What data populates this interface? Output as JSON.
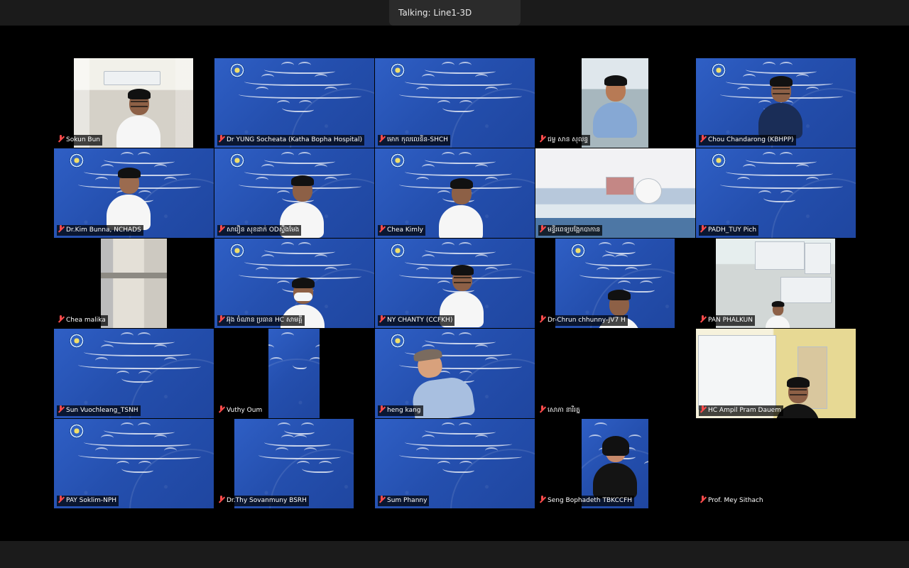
{
  "talking": {
    "label": "Talking: Line1-3D"
  },
  "colors": {
    "background": "#000000",
    "slide_blue": "#244fae",
    "muted_mic": "#ff4b4b"
  },
  "participants": [
    {
      "name": "Sokun Bun",
      "muted": true,
      "view": "camera"
    },
    {
      "name": "Dr YUNG Socheata (Katha Bopha Hospital)",
      "muted": true,
      "view": "slide"
    },
    {
      "name": "មោក កុលលេនីន-SHCH",
      "muted": true,
      "view": "slide"
    },
    {
      "name": "ជម្ល សាន សុលន្ទ",
      "muted": true,
      "view": "camera"
    },
    {
      "name": "Chou Chandarong (KBHPP)",
      "muted": true,
      "view": "slide-camera"
    },
    {
      "name": "Dr.Kim Bunna, NCHADS",
      "muted": true,
      "view": "slide-camera"
    },
    {
      "name": "សារឿន សុខដាក់ ODស្ទឹងមែង",
      "muted": true,
      "view": "slide-camera"
    },
    {
      "name": "Chea Kimly",
      "muted": true,
      "view": "slide-camera"
    },
    {
      "name": "មន្ទីរពេទ្យបង្អែកបាកាន",
      "muted": true,
      "view": "camera"
    },
    {
      "name": "PADH_TUY Pich",
      "muted": true,
      "view": "slide"
    },
    {
      "name": "Chea malika",
      "muted": true,
      "view": "camera"
    },
    {
      "name": "អ៊ុង ចំណាន ប្រធាន HC សាមគ្គី",
      "muted": true,
      "view": "slide-camera"
    },
    {
      "name": "NY CHANTY (CCFKH)",
      "muted": true,
      "view": "slide-camera"
    },
    {
      "name": "Dr-Chrun chhunny-JV7 H",
      "muted": true,
      "view": "slide-camera"
    },
    {
      "name": "PAN PHALKUN",
      "muted": true,
      "view": "camera"
    },
    {
      "name": "Sun Vuochleang_TSNH",
      "muted": true,
      "view": "slide"
    },
    {
      "name": "Vuthy Oum",
      "muted": true,
      "view": "slide"
    },
    {
      "name": "heng kang",
      "muted": true,
      "view": "slide-camera"
    },
    {
      "name": "សោភា នារីរត្ន",
      "muted": true,
      "view": "empty"
    },
    {
      "name": "HC Ampil Pram Dauem",
      "muted": true,
      "view": "camera"
    },
    {
      "name": "PAY Soklim-NPH",
      "muted": true,
      "view": "slide"
    },
    {
      "name": "Dr.Thy Sovanmuny BSRH",
      "muted": true,
      "view": "slide"
    },
    {
      "name": "Sum Phanny",
      "muted": true,
      "view": "slide"
    },
    {
      "name": "Seng Bophadeth TBKCCFH",
      "muted": true,
      "view": "camera"
    },
    {
      "name": "Prof. Mey Sithach",
      "muted": true,
      "view": "empty"
    }
  ]
}
